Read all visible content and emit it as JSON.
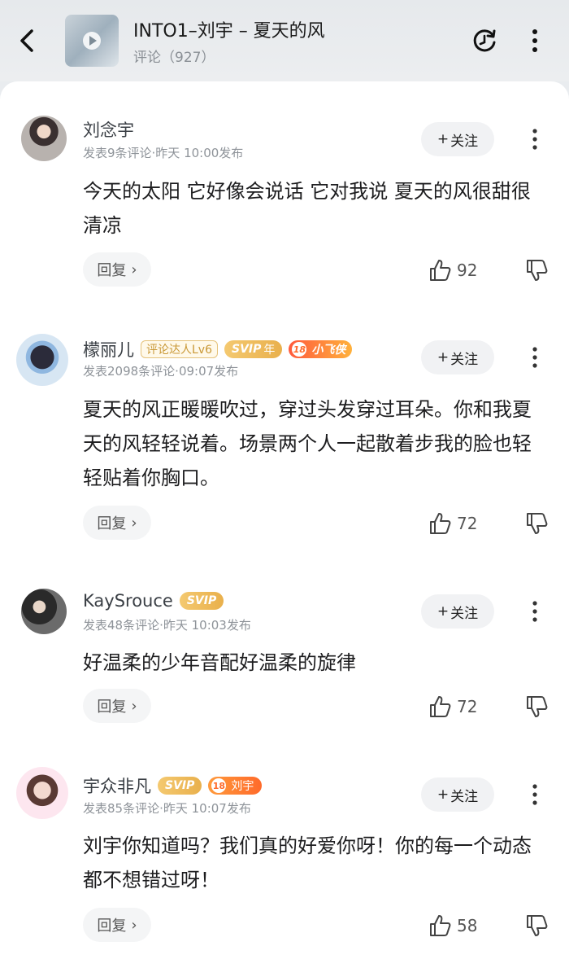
{
  "header": {
    "song_title": "INTO1–刘宇 – 夏天的风",
    "comment_label": "评论（927）"
  },
  "comments": [
    {
      "username": "刘念宇",
      "meta": "发表9条评论·昨天 10:00发布",
      "follow_label": "关注",
      "text": "今天的太阳 它好像会说话 它对我说 夏天的风很甜很清凉",
      "reply_label": "回复",
      "likes": "92",
      "badges": []
    },
    {
      "username": "檬丽儿",
      "meta": "发表2098条评论·09:07发布",
      "follow_label": "关注",
      "text": "夏天的风正暖暖吹过，穿过头发穿过耳朵。你和我夏天的风轻轻说着。场景两个人一起散着步我的脸也轻轻贴着你胸口。",
      "reply_label": "回复",
      "likes": "72",
      "badges": {
        "level": "评论达人Lv6",
        "svip": "SVIP",
        "svip_year": "年",
        "fan_num": "18",
        "xiaofei": "小飞侠"
      }
    },
    {
      "username": "KaySrouce",
      "meta": "发表48条评论·昨天 10:03发布",
      "follow_label": "关注",
      "text": "好温柔的少年音配好温柔的旋律",
      "reply_label": "回复",
      "likes": "72",
      "badges": {
        "svip": "SVIP"
      }
    },
    {
      "username": "宇众非凡",
      "meta": "发表85条评论·昨天 10:07发布",
      "follow_label": "关注",
      "text": "刘宇你知道吗？我们真的好爱你呀！你的每一个动态都不想错过呀！",
      "reply_label": "回复",
      "likes": "58",
      "badges": {
        "svip": "SVIP",
        "fan_num": "18",
        "fan_name": "刘宇"
      }
    }
  ],
  "colors": {
    "accent_gold": "#e9b04c",
    "fan_orange": "#ff6a2a",
    "text_primary": "#1d1d1f",
    "text_meta": "#8e9399"
  }
}
